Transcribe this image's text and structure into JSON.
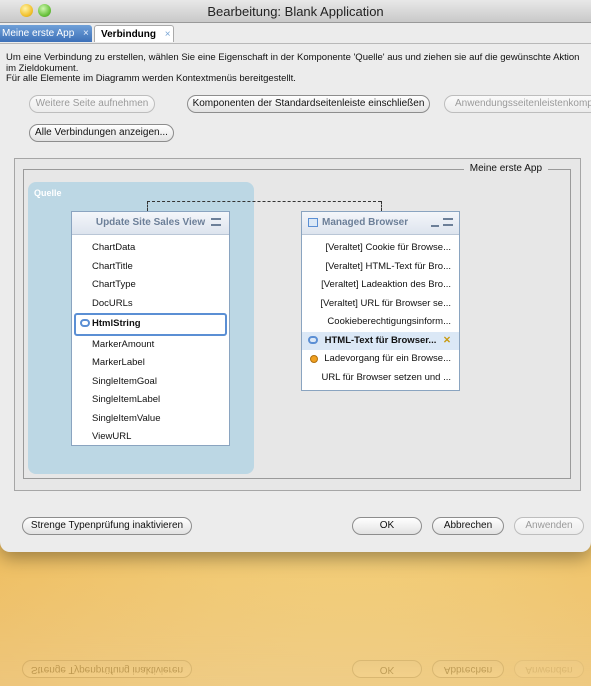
{
  "window": {
    "title": "Bearbeitung: Blank Application"
  },
  "tabs": [
    {
      "label": "Meine erste App",
      "close": "×"
    },
    {
      "label": "Verbindung",
      "close": "×"
    }
  ],
  "instructions": {
    "line1": "Um eine Verbindung zu erstellen, wählen Sie eine Eigenschaft in der Komponente 'Quelle' aus und ziehen sie auf die gewünschte Aktion im Zieldokument.",
    "line2": "Für alle Elemente im Diagramm werden Kontextmenüs bereitgestellt."
  },
  "toolbar": {
    "add_page": "Weitere Seite aufnehmen",
    "include_components": "Komponenten der Standardseitenleiste einschließen",
    "app_sidebar": "Anwendungsseitenleistenkompo",
    "show_all": "Alle Verbindungen anzeigen..."
  },
  "diagram": {
    "group_label": "Meine erste App",
    "source_region_label": "Quelle",
    "source": {
      "title": "Update Site Sales View",
      "items": [
        "ChartData",
        "ChartTitle",
        "ChartType",
        "DocURLs",
        "HtmlString",
        "MarkerAmount",
        "MarkerLabel",
        "SingleItemGoal",
        "SingleItemLabel",
        "SingleItemValue",
        "ViewURL"
      ]
    },
    "target": {
      "title": "Managed Browser",
      "items": [
        "[Veraltet] Cookie für Browse...",
        "[Veraltet] HTML-Text für Bro...",
        "[Veraltet] Ladeaktion des Bro...",
        "[Veraltet] URL für Browser se...",
        "Cookieberechtigungsinform...",
        "HTML-Text für Browser...",
        "Ladevorgang für ein Browse...",
        "URL für Browser setzen und ..."
      ]
    }
  },
  "footer": {
    "strict_typing": "Strenge Typenprüfung inaktivieren",
    "ok": "OK",
    "cancel": "Abbrechen",
    "apply": "Anwenden"
  }
}
